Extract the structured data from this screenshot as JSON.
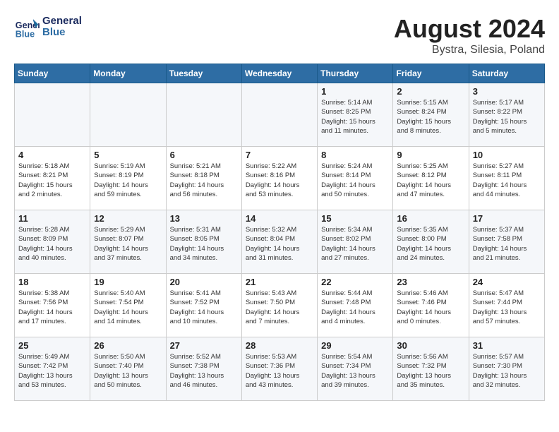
{
  "header": {
    "logo_line1": "General",
    "logo_line2": "Blue",
    "month": "August 2024",
    "location": "Bystra, Silesia, Poland"
  },
  "weekdays": [
    "Sunday",
    "Monday",
    "Tuesday",
    "Wednesday",
    "Thursday",
    "Friday",
    "Saturday"
  ],
  "weeks": [
    [
      {
        "day": "",
        "info": ""
      },
      {
        "day": "",
        "info": ""
      },
      {
        "day": "",
        "info": ""
      },
      {
        "day": "",
        "info": ""
      },
      {
        "day": "1",
        "info": "Sunrise: 5:14 AM\nSunset: 8:25 PM\nDaylight: 15 hours\nand 11 minutes."
      },
      {
        "day": "2",
        "info": "Sunrise: 5:15 AM\nSunset: 8:24 PM\nDaylight: 15 hours\nand 8 minutes."
      },
      {
        "day": "3",
        "info": "Sunrise: 5:17 AM\nSunset: 8:22 PM\nDaylight: 15 hours\nand 5 minutes."
      }
    ],
    [
      {
        "day": "4",
        "info": "Sunrise: 5:18 AM\nSunset: 8:21 PM\nDaylight: 15 hours\nand 2 minutes."
      },
      {
        "day": "5",
        "info": "Sunrise: 5:19 AM\nSunset: 8:19 PM\nDaylight: 14 hours\nand 59 minutes."
      },
      {
        "day": "6",
        "info": "Sunrise: 5:21 AM\nSunset: 8:18 PM\nDaylight: 14 hours\nand 56 minutes."
      },
      {
        "day": "7",
        "info": "Sunrise: 5:22 AM\nSunset: 8:16 PM\nDaylight: 14 hours\nand 53 minutes."
      },
      {
        "day": "8",
        "info": "Sunrise: 5:24 AM\nSunset: 8:14 PM\nDaylight: 14 hours\nand 50 minutes."
      },
      {
        "day": "9",
        "info": "Sunrise: 5:25 AM\nSunset: 8:12 PM\nDaylight: 14 hours\nand 47 minutes."
      },
      {
        "day": "10",
        "info": "Sunrise: 5:27 AM\nSunset: 8:11 PM\nDaylight: 14 hours\nand 44 minutes."
      }
    ],
    [
      {
        "day": "11",
        "info": "Sunrise: 5:28 AM\nSunset: 8:09 PM\nDaylight: 14 hours\nand 40 minutes."
      },
      {
        "day": "12",
        "info": "Sunrise: 5:29 AM\nSunset: 8:07 PM\nDaylight: 14 hours\nand 37 minutes."
      },
      {
        "day": "13",
        "info": "Sunrise: 5:31 AM\nSunset: 8:05 PM\nDaylight: 14 hours\nand 34 minutes."
      },
      {
        "day": "14",
        "info": "Sunrise: 5:32 AM\nSunset: 8:04 PM\nDaylight: 14 hours\nand 31 minutes."
      },
      {
        "day": "15",
        "info": "Sunrise: 5:34 AM\nSunset: 8:02 PM\nDaylight: 14 hours\nand 27 minutes."
      },
      {
        "day": "16",
        "info": "Sunrise: 5:35 AM\nSunset: 8:00 PM\nDaylight: 14 hours\nand 24 minutes."
      },
      {
        "day": "17",
        "info": "Sunrise: 5:37 AM\nSunset: 7:58 PM\nDaylight: 14 hours\nand 21 minutes."
      }
    ],
    [
      {
        "day": "18",
        "info": "Sunrise: 5:38 AM\nSunset: 7:56 PM\nDaylight: 14 hours\nand 17 minutes."
      },
      {
        "day": "19",
        "info": "Sunrise: 5:40 AM\nSunset: 7:54 PM\nDaylight: 14 hours\nand 14 minutes."
      },
      {
        "day": "20",
        "info": "Sunrise: 5:41 AM\nSunset: 7:52 PM\nDaylight: 14 hours\nand 10 minutes."
      },
      {
        "day": "21",
        "info": "Sunrise: 5:43 AM\nSunset: 7:50 PM\nDaylight: 14 hours\nand 7 minutes."
      },
      {
        "day": "22",
        "info": "Sunrise: 5:44 AM\nSunset: 7:48 PM\nDaylight: 14 hours\nand 4 minutes."
      },
      {
        "day": "23",
        "info": "Sunrise: 5:46 AM\nSunset: 7:46 PM\nDaylight: 14 hours\nand 0 minutes."
      },
      {
        "day": "24",
        "info": "Sunrise: 5:47 AM\nSunset: 7:44 PM\nDaylight: 13 hours\nand 57 minutes."
      }
    ],
    [
      {
        "day": "25",
        "info": "Sunrise: 5:49 AM\nSunset: 7:42 PM\nDaylight: 13 hours\nand 53 minutes."
      },
      {
        "day": "26",
        "info": "Sunrise: 5:50 AM\nSunset: 7:40 PM\nDaylight: 13 hours\nand 50 minutes."
      },
      {
        "day": "27",
        "info": "Sunrise: 5:52 AM\nSunset: 7:38 PM\nDaylight: 13 hours\nand 46 minutes."
      },
      {
        "day": "28",
        "info": "Sunrise: 5:53 AM\nSunset: 7:36 PM\nDaylight: 13 hours\nand 43 minutes."
      },
      {
        "day": "29",
        "info": "Sunrise: 5:54 AM\nSunset: 7:34 PM\nDaylight: 13 hours\nand 39 minutes."
      },
      {
        "day": "30",
        "info": "Sunrise: 5:56 AM\nSunset: 7:32 PM\nDaylight: 13 hours\nand 35 minutes."
      },
      {
        "day": "31",
        "info": "Sunrise: 5:57 AM\nSunset: 7:30 PM\nDaylight: 13 hours\nand 32 minutes."
      }
    ]
  ]
}
